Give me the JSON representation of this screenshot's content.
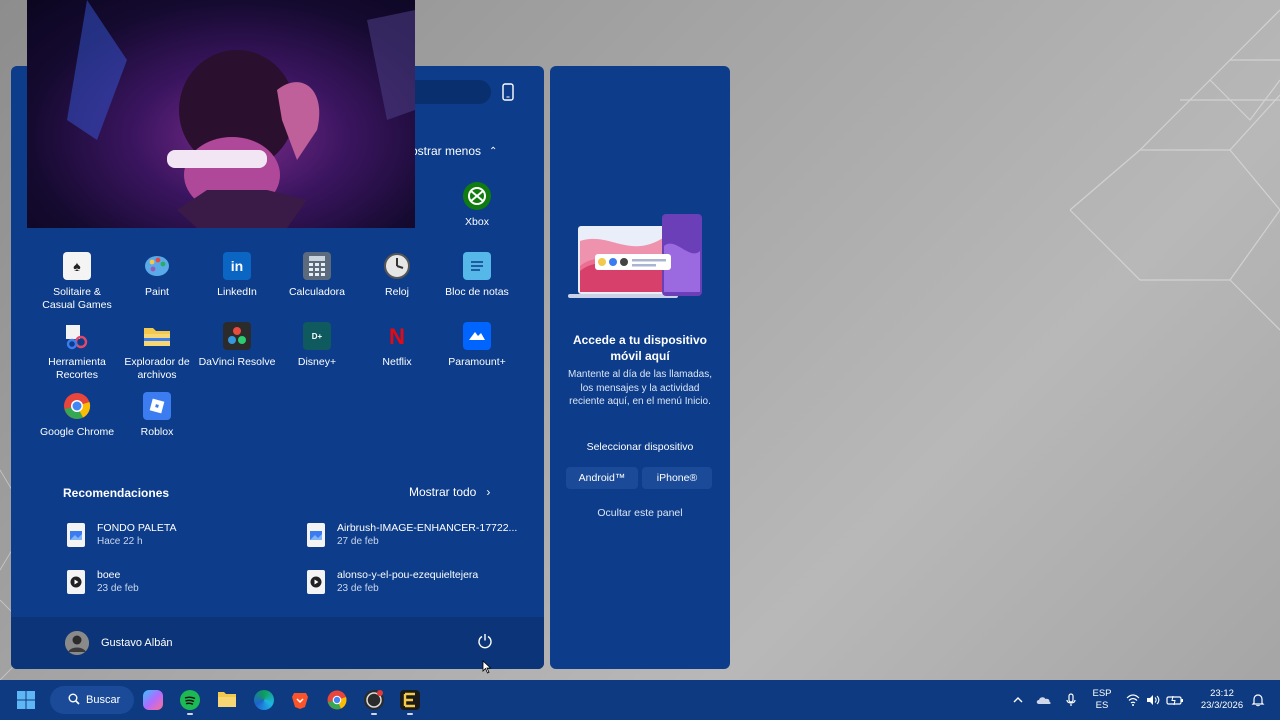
{
  "start_menu": {
    "show_less_label": "ostrar menos",
    "apps": [
      {
        "label": "Xbox",
        "icon": "xbox-icon",
        "color": "#107c10"
      },
      {
        "label": "Solitaire & Casual Games",
        "icon": "solitaire-icon",
        "color": "#1c6b3a"
      },
      {
        "label": "Paint",
        "icon": "paint-icon",
        "color": "#2a8fd6"
      },
      {
        "label": "LinkedIn",
        "icon": "linkedin-icon",
        "color": "#0a66c2"
      },
      {
        "label": "Calculadora",
        "icon": "calculator-icon",
        "color": "#5b6b7d"
      },
      {
        "label": "Reloj",
        "icon": "clock-icon",
        "color": "#e6e6e6"
      },
      {
        "label": "Bloc de notas",
        "icon": "notepad-icon",
        "color": "#55b8e8"
      },
      {
        "label": "Herramienta Recortes",
        "icon": "snipping-tool-icon",
        "color": "#e04a6a"
      },
      {
        "label": "Explorador de archivos",
        "icon": "folder-icon",
        "color": "#f2c94c"
      },
      {
        "label": "DaVinci Resolve",
        "icon": "davinci-icon",
        "color": "#2b2b2b"
      },
      {
        "label": "Disney+",
        "icon": "disney-plus-icon",
        "color": "#0e5a5e"
      },
      {
        "label": "Netflix",
        "icon": "netflix-icon",
        "color": "#0d3d8a"
      },
      {
        "label": "Paramount+",
        "icon": "paramount-icon",
        "color": "#0064ff"
      },
      {
        "label": "Google Chrome",
        "icon": "chrome-icon",
        "color": "#e8453c"
      },
      {
        "label": "Roblox",
        "icon": "roblox-icon",
        "color": "#3b7df0"
      }
    ],
    "recommendations_title": "Recomendaciones",
    "show_all_label": "Mostrar todo",
    "recommendations": [
      {
        "name": "FONDO PALETA",
        "time": "Hace 22 h",
        "type": "image"
      },
      {
        "name": "Airbrush-IMAGE-ENHANCER-17722...",
        "time": "27 de feb",
        "type": "image"
      },
      {
        "name": "boee",
        "time": "23 de feb",
        "type": "video"
      },
      {
        "name": "alonso-y-el-pou-ezequieltejera",
        "time": "23 de feb",
        "type": "video"
      }
    ],
    "user_name": "Gustavo Albán"
  },
  "phone_panel": {
    "title": "Accede a tu dispositivo móvil aquí",
    "description": "Mantente al día de las llamadas, los mensajes y la actividad reciente aquí, en el menú Inicio.",
    "select_label": "Seleccionar dispositivo",
    "android_label": "Android™",
    "iphone_label": "iPhone®",
    "hide_label": "Ocultar este panel"
  },
  "taskbar": {
    "search_label": "Buscar",
    "lang_top": "ESP",
    "lang_bottom": "ES",
    "time": "23:12",
    "date": "23/3/2026"
  }
}
